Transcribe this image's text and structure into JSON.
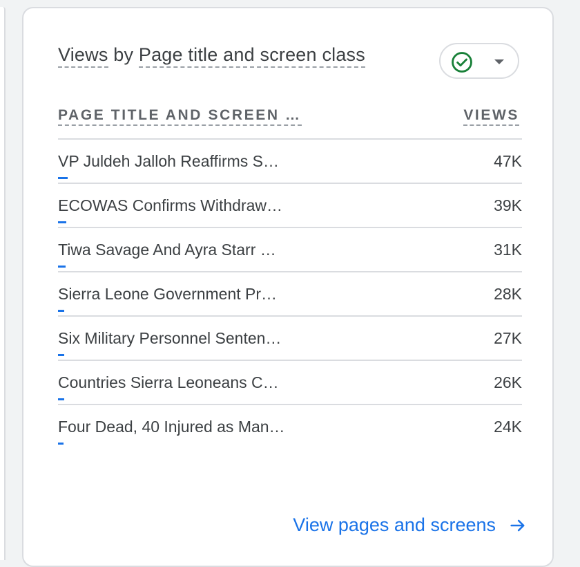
{
  "card": {
    "title_metric": "Views",
    "title_by": "by",
    "title_dimension": "Page title and screen class"
  },
  "compare_button": {
    "status_icon": "check-circle-icon",
    "dropdown_icon": "caret-down-icon",
    "accent_color": "#188038"
  },
  "table": {
    "columns": [
      "PAGE TITLE AND SCREEN …",
      "VIEWS"
    ],
    "max_views": 47000,
    "rows": [
      {
        "title": "VP Juldeh Jalloh Reaffirms S…",
        "views": "47K",
        "share": 0.021
      },
      {
        "title": "ECOWAS Confirms Withdraw…",
        "views": "39K",
        "share": 0.018
      },
      {
        "title": "Tiwa Savage And Ayra Starr …",
        "views": "31K",
        "share": 0.016
      },
      {
        "title": "Sierra Leone Government Pr…",
        "views": "28K",
        "share": 0.014
      },
      {
        "title": "Six Military Personnel Senten…",
        "views": "27K",
        "share": 0.013
      },
      {
        "title": "Countries Sierra Leoneans C…",
        "views": "26K",
        "share": 0.013
      },
      {
        "title": "Four Dead, 40 Injured as Man…",
        "views": "24K",
        "share": 0.012
      }
    ],
    "bar_color": "#1a73e8"
  },
  "footer": {
    "link_label": "View pages and screens",
    "link_icon": "arrow-right-icon"
  }
}
